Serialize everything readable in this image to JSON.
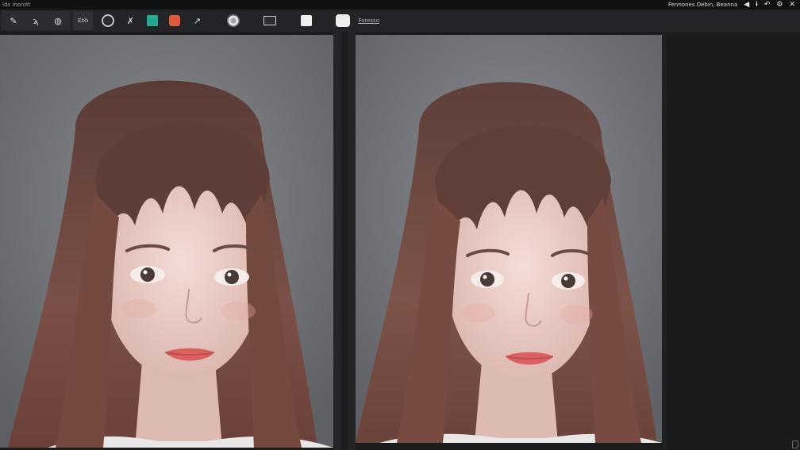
{
  "app": {
    "title": "Ids inorott"
  },
  "titlebar": {
    "info": "Fennones Debin, Beanna",
    "icons": [
      "play-back-icon",
      "text-cursor-icon",
      "undo-icon",
      "settings-icon",
      "close-icon"
    ]
  },
  "toolbar": {
    "left_tools": [
      "brush-icon",
      "smudge-icon",
      "scan-icon"
    ],
    "mode_label": "Ebb",
    "tools": [
      "spiral-icon",
      "cross-tool-icon",
      "teal-swatch-icon",
      "palette-icon",
      "curve-tool-icon",
      "lens-icon",
      "screen-icon",
      "card-icon",
      "bubble-icon"
    ],
    "text_link": "Foresso"
  },
  "colors": {
    "accent_teal": "#22a98f",
    "accent_red": "#e25a3b",
    "canvas_bg": "#6f7074",
    "chrome_bg": "#232427"
  },
  "panels": {
    "left": {
      "content": "portrait-image"
    },
    "right": {
      "content": "portrait-image"
    }
  }
}
